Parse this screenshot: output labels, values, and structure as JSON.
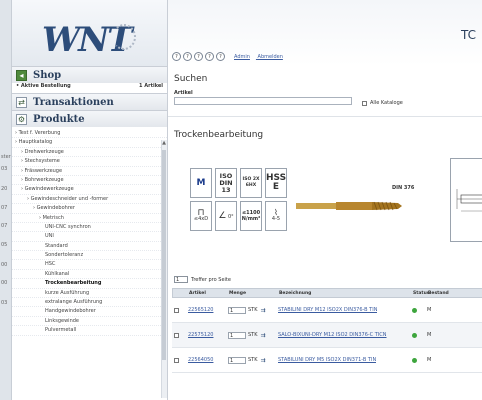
{
  "edge": {
    "rows": [
      "ster",
      "03",
      "20",
      "07",
      "07",
      "05",
      "00",
      "00",
      "03"
    ]
  },
  "sidebar": {
    "shop": {
      "title": "Shop",
      "cart_label": "• Aktive Bestellung",
      "cart_count": "1 Artikel"
    },
    "transactions": {
      "title": "Transaktionen"
    },
    "products": {
      "title": "Produkte"
    },
    "tree": [
      {
        "label": "Test f. Vererbung",
        "level": 0
      },
      {
        "label": "Hauptkatalog",
        "level": 0
      },
      {
        "label": "Drehwerkzeuge",
        "level": 1
      },
      {
        "label": "Stechsysteme",
        "level": 1
      },
      {
        "label": "Fräswerkzeuge",
        "level": 1
      },
      {
        "label": "Bohrwerkzeuge",
        "level": 1
      },
      {
        "label": "Gewindewerkzeuge",
        "level": 1
      },
      {
        "label": "Gewindeschneider und -former",
        "level": 2
      },
      {
        "label": "Gewindebohrer",
        "level": 3
      },
      {
        "label": "Metrisch",
        "level": 4
      },
      {
        "label": "UNI-CNC synchron",
        "level": 5
      },
      {
        "label": "UNI",
        "level": 5
      },
      {
        "label": "Standard",
        "level": 5
      },
      {
        "label": "Sondertoleranz",
        "level": 5
      },
      {
        "label": "HSC",
        "level": 5
      },
      {
        "label": "Kühlkanal",
        "level": 5
      },
      {
        "label": "Trockenbearbeitung",
        "level": 5,
        "selected": true
      },
      {
        "label": "kurze Ausführung",
        "level": 5
      },
      {
        "label": "extralange Ausführung",
        "level": 5
      },
      {
        "label": "Handgewindebohrer",
        "level": 5
      },
      {
        "label": "Linksgewinde",
        "level": 5
      },
      {
        "label": "Pulvermetall",
        "level": 5
      }
    ]
  },
  "topbar": {
    "circles": [
      "?",
      "?",
      "?",
      "?",
      "?"
    ],
    "admin_link": "Admin",
    "logout_link": "Abmelden",
    "corner_text": "TC"
  },
  "search": {
    "title": "Suchen",
    "article_label": "Artikel",
    "article_value": "",
    "all_catalogs_label": "Alle Kataloge"
  },
  "section": {
    "title": "Trockenbearbeitung"
  },
  "pictograms": {
    "m": "M",
    "iso_lines": [
      "ISO",
      "DIN",
      "13"
    ],
    "iso2x_lines": [
      "ISO 2X",
      "6HX"
    ],
    "hss_lines": [
      "HSS",
      "E"
    ],
    "size_text": "≤4xD",
    "angle_text": "0°",
    "strength_lines": [
      "≤1100",
      "N/mm²"
    ],
    "deg_lines": [
      "1",
      "4-5"
    ]
  },
  "din_label": "DIN 376",
  "pager": {
    "value": "1",
    "label": "Treffer pro Seite"
  },
  "table": {
    "columns": [
      "Artikel",
      "Menge",
      "Bezeichnung",
      "Status",
      "Bestand"
    ],
    "rows": [
      {
        "article": "22565120",
        "qty": "1",
        "unit": "STK",
        "desc": "STABILINI DRY M12 ISO2X DIN376-B TIN",
        "stock": "M"
      },
      {
        "article": "22575120",
        "qty": "1",
        "unit": "STK",
        "desc": "SALO-BIXUNI-DRY M12 ISO2 DIN376-C TICN",
        "stock": "M"
      },
      {
        "article": "22564050",
        "qty": "1",
        "unit": "STK",
        "desc": "STABILUNI DRY M5 ISO2X DIN371-B TIN",
        "stock": "M"
      }
    ]
  },
  "colors": {
    "brand": "#2d4d7a",
    "status_ok": "#3da53d",
    "link": "#3a5ba0"
  }
}
